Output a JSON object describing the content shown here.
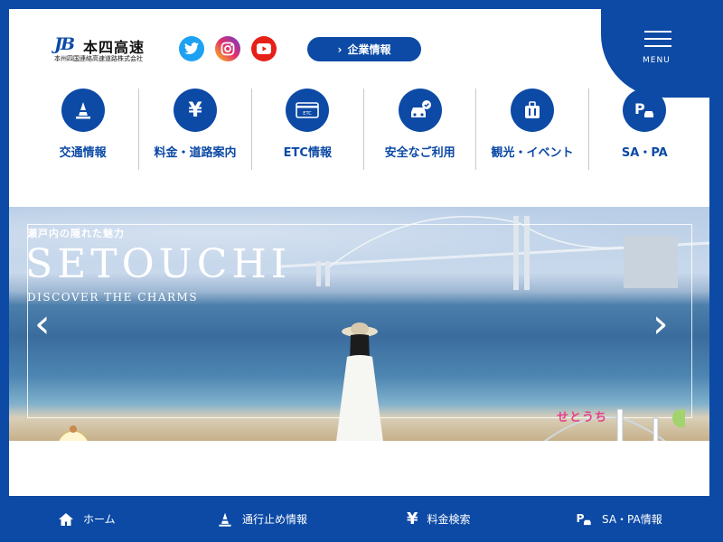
{
  "header": {
    "logo_mark": "JB",
    "logo_name": "本四高速",
    "logo_sub": "本州四国連絡高速道路株式会社",
    "social": [
      "twitter-icon",
      "instagram-icon",
      "youtube-icon"
    ],
    "corp_button": "企業情報",
    "menu_label": "MENU"
  },
  "nav": {
    "items": [
      {
        "label": "交通情報",
        "icon": "traffic-cone-icon"
      },
      {
        "label": "料金・道路案内",
        "icon": "yen-icon"
      },
      {
        "label": "ETC情報",
        "icon": "etc-card-icon"
      },
      {
        "label": "安全なご利用",
        "icon": "car-check-icon"
      },
      {
        "label": "観光・イベント",
        "icon": "suitcase-icon"
      },
      {
        "label": "SA・PA",
        "icon": "parking-car-icon"
      }
    ]
  },
  "hero": {
    "kicker": "瀬戸内の隠れた魅力",
    "title": "SETOUCHI",
    "subtitle": "DISCOVER THE CHARMS",
    "logo_text": "せとうち"
  },
  "bottom_nav": {
    "items": [
      {
        "label": "ホーム",
        "icon": "home-icon"
      },
      {
        "label": "通行止め情報",
        "icon": "traffic-cone-icon"
      },
      {
        "label": "料金検索",
        "icon": "yen-icon"
      },
      {
        "label": "SA・PA情報",
        "icon": "parking-car-icon"
      }
    ]
  },
  "colors": {
    "brand": "#0c4aa6",
    "white": "#ffffff"
  }
}
